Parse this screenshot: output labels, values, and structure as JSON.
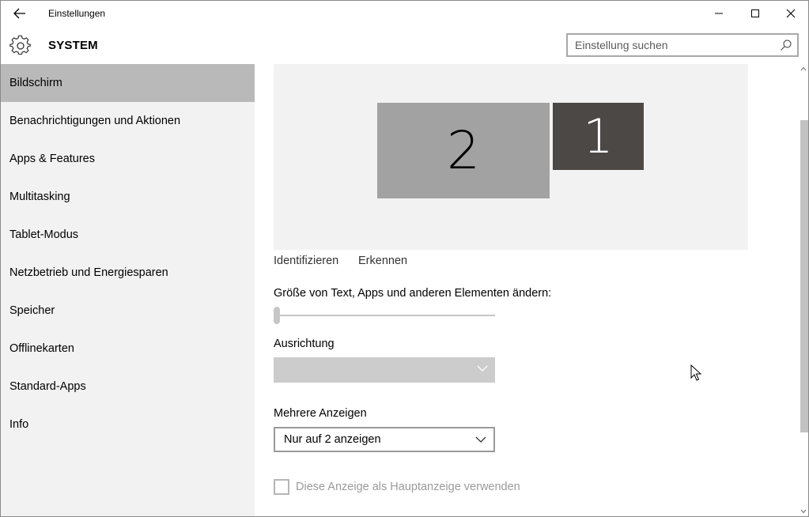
{
  "titlebar": {
    "title": "Einstellungen"
  },
  "header": {
    "section_title": "SYSTEM",
    "search_placeholder": "Einstellung suchen"
  },
  "sidebar": {
    "items": [
      {
        "label": "Bildschirm",
        "active": true
      },
      {
        "label": "Benachrichtigungen und Aktionen",
        "active": false
      },
      {
        "label": "Apps & Features",
        "active": false
      },
      {
        "label": "Multitasking",
        "active": false
      },
      {
        "label": "Tablet-Modus",
        "active": false
      },
      {
        "label": "Netzbetrieb und Energiesparen",
        "active": false
      },
      {
        "label": "Speicher",
        "active": false
      },
      {
        "label": "Offlinekarten",
        "active": false
      },
      {
        "label": "Standard-Apps",
        "active": false
      },
      {
        "label": "Info",
        "active": false
      }
    ]
  },
  "main": {
    "monitors": [
      {
        "number": "2",
        "selected": false
      },
      {
        "number": "1",
        "selected": true
      }
    ],
    "identify_link": "Identifizieren",
    "detect_link": "Erkennen",
    "scale_label": "Größe von Text, Apps und anderen Elementen ändern:",
    "scale_level": 0,
    "orientation_label": "Ausrichtung",
    "orientation_value": "",
    "multiple_displays_label": "Mehrere Anzeigen",
    "multiple_displays_value": "Nur auf 2 anzeigen",
    "main_display_checkbox_label": "Diese Anzeige als Hauptanzeige verwenden",
    "main_display_checked": false
  },
  "colors": {
    "sidebar_bg": "#f2f2f2",
    "sidebar_active": "#b9b9b9",
    "monitor_selected": "#4c4846",
    "monitor_unselected": "#a2a2a2"
  }
}
